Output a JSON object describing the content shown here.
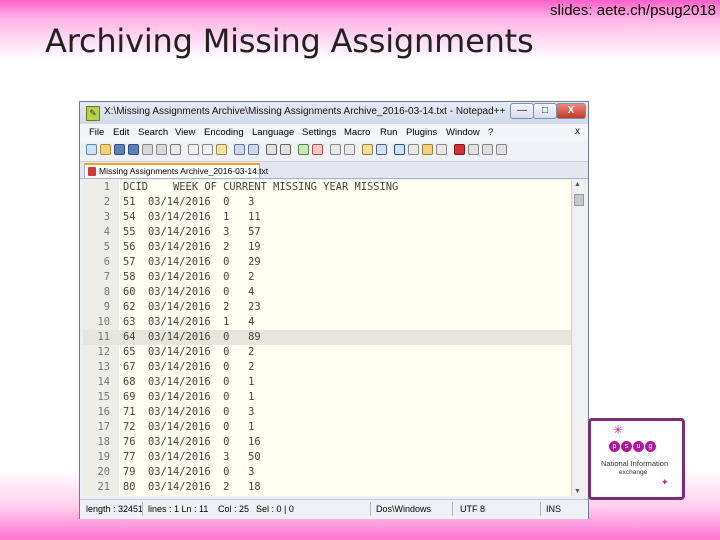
{
  "slide": {
    "url": "slides: aete.ch/psug2018",
    "title": "Archiving Missing Assignments"
  },
  "window": {
    "title": "X:\\Missing Assignments Archive\\Missing Assignments Archive_2016-03-14.txt - Notepad++",
    "buttons": {
      "minimize": "—",
      "maximize": "□",
      "close": "X"
    },
    "menu": [
      "File",
      "Edit",
      "Search",
      "View",
      "Encoding",
      "Language",
      "Settings",
      "Macro",
      "Run",
      "Plugins",
      "Window",
      "?"
    ],
    "menu_close": "x",
    "tab_label": "Missing Assignments Archive_2016-03-14.txt",
    "current_line": 11
  },
  "editor": {
    "lines": [
      {
        "n": "1",
        "text": "DCID    WEEK OF CURRENT MISSING YEAR MISSING"
      },
      {
        "n": "2",
        "text": "51  03/14/2016  0   3"
      },
      {
        "n": "3",
        "text": "54  03/14/2016  1   11"
      },
      {
        "n": "4",
        "text": "55  03/14/2016  3   57"
      },
      {
        "n": "5",
        "text": "56  03/14/2016  2   19"
      },
      {
        "n": "6",
        "text": "57  03/14/2016  0   29"
      },
      {
        "n": "7",
        "text": "58  03/14/2016  0   2"
      },
      {
        "n": "8",
        "text": "60  03/14/2016  0   4"
      },
      {
        "n": "9",
        "text": "62  03/14/2016  2   23"
      },
      {
        "n": "10",
        "text": "63  03/14/2016  1   4"
      },
      {
        "n": "11",
        "text": "64  03/14/2016  0   89"
      },
      {
        "n": "12",
        "text": "65  03/14/2016  0   2"
      },
      {
        "n": "13",
        "text": "67  03/14/2016  0   2"
      },
      {
        "n": "14",
        "text": "68  03/14/2016  0   1"
      },
      {
        "n": "15",
        "text": "69  03/14/2016  0   1"
      },
      {
        "n": "16",
        "text": "71  03/14/2016  0   3"
      },
      {
        "n": "17",
        "text": "72  03/14/2016  0   1"
      },
      {
        "n": "18",
        "text": "76  03/14/2016  0   16"
      },
      {
        "n": "19",
        "text": "77  03/14/2016  3   50"
      },
      {
        "n": "20",
        "text": "79  03/14/2016  0   3"
      },
      {
        "n": "21",
        "text": "80  03/14/2016  2   18"
      }
    ]
  },
  "status": {
    "length": "length : 32451",
    "lines": "lines : 1 Ln : 11",
    "col": "Col : 25",
    "sel": "Sel : 0 | 0",
    "eol": "Dos\\Windows",
    "encoding": "UTF 8",
    "mode": "INS"
  },
  "logo": {
    "letters": [
      "p",
      "s",
      "u",
      "g"
    ],
    "line1": "National Information",
    "line2": "exchange"
  },
  "colors": {
    "accent_pink": "#ff5fc8",
    "logo_purple": "#b0179a",
    "editor_bg": "#fffff2"
  }
}
